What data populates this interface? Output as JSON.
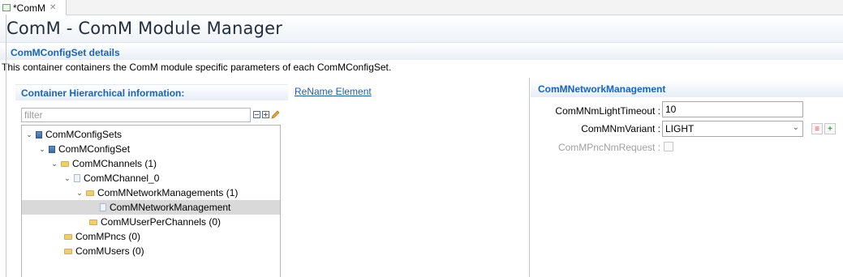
{
  "tab": {
    "label": "*ComM",
    "close": "✕"
  },
  "page": {
    "title": "ComM - ComM Module Manager"
  },
  "section": {
    "title": "ComMConfigSet details",
    "description": "This container containers the ComM module specific parameters of each ComMConfigSet."
  },
  "container": {
    "title": "Container Hierarchical information:",
    "rename_link": "ReName Element",
    "filter_placeholder": "filter"
  },
  "tree": [
    {
      "label": "ComMConfigSets",
      "twisty": "⌄",
      "icon": "blue-module-icon"
    },
    {
      "label": "ComMConfigSet",
      "twisty": "⌄",
      "icon": "blue-module-icon"
    },
    {
      "label": "ComMChannels (1)",
      "twisty": "⌄",
      "icon": "folder-icon"
    },
    {
      "label": "ComMChannel_0",
      "twisty": "⌄",
      "icon": "document-icon"
    },
    {
      "label": "ComMNetworkManagements (1)",
      "twisty": "⌄",
      "icon": "folder-icon"
    },
    {
      "label": "ComMNetworkManagement",
      "twisty": "",
      "icon": "document-icon",
      "selected": true
    },
    {
      "label": "ComMUserPerChannels (0)",
      "twisty": "",
      "icon": "folder-icon"
    },
    {
      "label": "ComMPncs (0)",
      "twisty": "",
      "icon": "folder-icon"
    },
    {
      "label": "ComMUsers (0)",
      "twisty": "",
      "icon": "folder-icon"
    }
  ],
  "network_management": {
    "title": "ComMNetworkManagement",
    "light_timeout_label": "ComMNmLightTimeout :",
    "light_timeout_value": "10",
    "variant_label": "ComMNmVariant :",
    "variant_value": "LIGHT",
    "pnc_request_label": "ComMPncNmRequest :"
  },
  "colors": {
    "accent": "#1565c0",
    "selection": "#d9d9d9",
    "add_button": "#3a9b3a",
    "remove_button": "#d94a3a"
  }
}
